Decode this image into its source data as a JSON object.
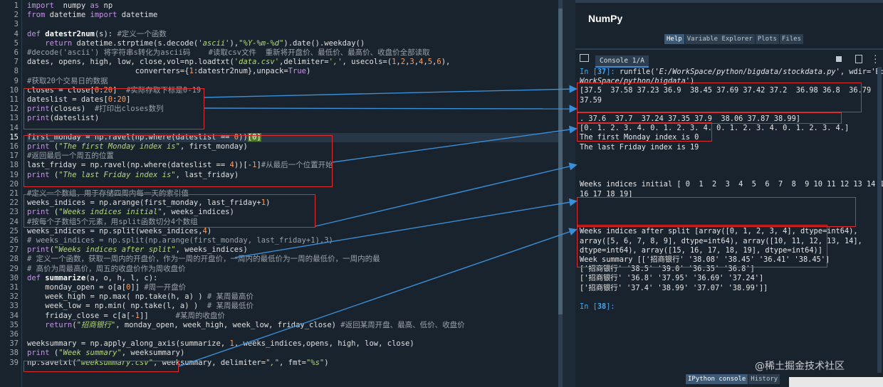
{
  "editor": {
    "lines": [
      {
        "n": "1",
        "segs": [
          [
            "kw",
            "import"
          ],
          [
            "",
            "  numpy "
          ],
          [
            "kw",
            "as"
          ],
          [
            "",
            " np"
          ]
        ]
      },
      {
        "n": "2",
        "segs": [
          [
            "kw",
            "from"
          ],
          [
            "",
            " datetime "
          ],
          [
            "kw",
            "import"
          ],
          [
            "",
            " datetime"
          ]
        ]
      },
      {
        "n": "3",
        "segs": []
      },
      {
        "n": "4",
        "segs": [
          [
            "kw",
            "def"
          ],
          [
            "",
            " "
          ],
          [
            "fnd",
            "datestr2num"
          ],
          [
            "",
            "(s): "
          ],
          [
            "cm",
            "#定义一个函数"
          ]
        ]
      },
      {
        "n": "5",
        "segs": [
          [
            "",
            "    "
          ],
          [
            "kw",
            "return"
          ],
          [
            "",
            " datetime.strptime(s.decode("
          ],
          [
            "str",
            "'ascii'"
          ],
          [
            "",
            "),"
          ],
          [
            "str",
            "\"%Y-%m-%d\""
          ],
          [
            "",
            ").date().weekday()"
          ]
        ]
      },
      {
        "n": "6",
        "segs": [
          [
            "cm",
            "#decode('ascii') 将字符串s转化为ascii码    #读取csv文件  重新将开盘价、最低价、最高价、收盘价全部读取"
          ]
        ]
      },
      {
        "n": "7",
        "segs": [
          [
            "",
            "dates, opens, high, low, close,vol=np.loadtxt("
          ],
          [
            "str",
            "'data.csv'"
          ],
          [
            "",
            ",delimiter="
          ],
          [
            "str",
            "','"
          ],
          [
            "",
            ", usecols=("
          ],
          [
            "num",
            "1"
          ],
          [
            "",
            ","
          ],
          [
            "num",
            "2"
          ],
          [
            "",
            ","
          ],
          [
            "num",
            "3"
          ],
          [
            "",
            ","
          ],
          [
            "num",
            "4"
          ],
          [
            "",
            ","
          ],
          [
            "num",
            "5"
          ],
          [
            "",
            ","
          ],
          [
            "num",
            "6"
          ],
          [
            "",
            "),"
          ]
        ]
      },
      {
        "n": "8",
        "segs": [
          [
            "",
            "                        converters={"
          ],
          [
            "num",
            "1"
          ],
          [
            "",
            ":datestr2num},unpack="
          ],
          [
            "kw",
            "True"
          ],
          [
            "",
            ")"
          ]
        ]
      },
      {
        "n": "9",
        "segs": [
          [
            "cm",
            "#获取20个交易日的数据"
          ]
        ]
      },
      {
        "n": "10",
        "segs": [
          [
            "",
            "closes = close["
          ],
          [
            "num",
            "0"
          ],
          [
            "",
            ":"
          ],
          [
            "num",
            "20"
          ],
          [
            "",
            "]  "
          ],
          [
            "cm",
            "#实际存取下标是0-19"
          ]
        ]
      },
      {
        "n": "11",
        "segs": [
          [
            "",
            "dateslist = dates["
          ],
          [
            "num",
            "0"
          ],
          [
            "",
            ":"
          ],
          [
            "num",
            "20"
          ],
          [
            "",
            "]"
          ]
        ]
      },
      {
        "n": "12",
        "segs": [
          [
            "kw",
            "print"
          ],
          [
            "",
            "(closes)  "
          ],
          [
            "cm",
            "#打印出closes数列"
          ]
        ]
      },
      {
        "n": "13",
        "segs": [
          [
            "kw",
            "print"
          ],
          [
            "",
            "(dateslist)"
          ]
        ]
      },
      {
        "n": "14",
        "segs": []
      },
      {
        "n": "15",
        "cur": true,
        "segs": [
          [
            "",
            "first_monday = np.ravel(np.where(dateslist == "
          ],
          [
            "num",
            "0"
          ],
          [
            "",
            "))"
          ],
          [
            "sel",
            "[0]"
          ]
        ]
      },
      {
        "n": "16",
        "segs": [
          [
            "kw",
            "print"
          ],
          [
            "",
            " ("
          ],
          [
            "str",
            "\"The first Monday index is\""
          ],
          [
            "",
            ", first_monday)"
          ]
        ]
      },
      {
        "n": "17",
        "segs": [
          [
            "cm",
            "#返回最后一个周五的位置"
          ]
        ]
      },
      {
        "n": "18",
        "segs": [
          [
            "",
            "last_friday = np.ravel(np.where(dateslist == "
          ],
          [
            "num",
            "4"
          ],
          [
            "",
            "))[-"
          ],
          [
            "num",
            "1"
          ],
          [
            "",
            "]"
          ],
          [
            "cm",
            "#从最后一个位置开始"
          ]
        ]
      },
      {
        "n": "19",
        "segs": [
          [
            "kw",
            "print"
          ],
          [
            "",
            " ("
          ],
          [
            "str",
            "\"The last Friday index is\""
          ],
          [
            "",
            ", last_friday)"
          ]
        ]
      },
      {
        "n": "20",
        "segs": []
      },
      {
        "n": "21",
        "segs": [
          [
            "cm",
            "#定义一个数组，用于存储四周内每一天的索引值"
          ]
        ]
      },
      {
        "n": "22",
        "segs": [
          [
            "",
            "weeks_indices = np.arange(first_monday, last_friday+"
          ],
          [
            "num",
            "1"
          ],
          [
            "",
            ")"
          ]
        ]
      },
      {
        "n": "23",
        "segs": [
          [
            "kw",
            "print"
          ],
          [
            "",
            " ("
          ],
          [
            "str",
            "\"Weeks indices initial\""
          ],
          [
            "",
            ", weeks_indices)"
          ]
        ]
      },
      {
        "n": "24",
        "segs": [
          [
            "cm",
            "#按每个子数组5个元素，用split函数切分4个数组"
          ]
        ]
      },
      {
        "n": "25",
        "segs": [
          [
            "",
            "weeks_indices = np.split(weeks_indices,"
          ],
          [
            "num",
            "4"
          ],
          [
            "",
            ")"
          ]
        ]
      },
      {
        "n": "26",
        "segs": [
          [
            "cm",
            "# weeks_indices = np.split(np.arange(first_monday, last_friday+1),3)"
          ]
        ]
      },
      {
        "n": "27",
        "segs": [
          [
            "kw",
            "print"
          ],
          [
            "",
            "("
          ],
          [
            "str",
            "\"Weeks indices after split\""
          ],
          [
            "",
            ", weeks_indices)"
          ]
        ]
      },
      {
        "n": "28",
        "segs": [
          [
            "cm",
            "# 定义一个函数，获取一周内的开盘价，作为一周的开盘价，一周内的最低价为一周的最低价，一周内的最"
          ]
        ]
      },
      {
        "n": "29",
        "segs": [
          [
            "cm",
            "# 高价为周最高价，周五的收盘价作为周收盘价"
          ]
        ]
      },
      {
        "n": "30",
        "segs": [
          [
            "kw",
            "def"
          ],
          [
            "",
            " "
          ],
          [
            "fnd",
            "summarize"
          ],
          [
            "",
            "(a, o, h, l, c):"
          ]
        ]
      },
      {
        "n": "31",
        "segs": [
          [
            "",
            "    monday_open = o[a["
          ],
          [
            "num",
            "0"
          ],
          [
            "",
            "]] "
          ],
          [
            "cm",
            "#周一开盘价"
          ]
        ]
      },
      {
        "n": "32",
        "segs": [
          [
            "",
            "    week_high = np.max( np.take(h, a) ) "
          ],
          [
            "cm",
            "# 某周最高价"
          ]
        ]
      },
      {
        "n": "33",
        "segs": [
          [
            "",
            "    week_low = np.min( np.take(l, a) )  "
          ],
          [
            "cm",
            "# 某周最低价"
          ]
        ]
      },
      {
        "n": "34",
        "segs": [
          [
            "",
            "    friday_close = c[a[-"
          ],
          [
            "num",
            "1"
          ],
          [
            "",
            "]]      "
          ],
          [
            "cm",
            "#某周的收盘价"
          ]
        ]
      },
      {
        "n": "35",
        "segs": [
          [
            "",
            "    "
          ],
          [
            "kw",
            "return"
          ],
          [
            "",
            "("
          ],
          [
            "str",
            "\"招商银行\""
          ],
          [
            "",
            ", monday_open, week_high, week_low, friday_close) "
          ],
          [
            "cm",
            "#返回某周开盘、最高、低价、收盘价"
          ]
        ]
      },
      {
        "n": "36",
        "segs": []
      },
      {
        "n": "37",
        "segs": [
          [
            "",
            "weeksummary = np.apply_along_axis(summarize, "
          ],
          [
            "num",
            "1"
          ],
          [
            "",
            ", weeks_indices,opens, high, low, close)"
          ]
        ]
      },
      {
        "n": "38",
        "segs": [
          [
            "kw",
            "print"
          ],
          [
            "",
            " ("
          ],
          [
            "str",
            "\"Week summary\""
          ],
          [
            "",
            ", weeksummary)"
          ]
        ]
      },
      {
        "n": "39",
        "segs": [
          [
            "",
            "np.savetxt("
          ],
          [
            "str",
            "\"weeksummary.csv\""
          ],
          [
            "",
            ", weeksummary, delimiter="
          ],
          [
            "str",
            "\",\""
          ],
          [
            "",
            ", fmt="
          ],
          [
            "str",
            "\"%s\""
          ],
          [
            "",
            ")"
          ]
        ]
      }
    ]
  },
  "help": {
    "title": "NumPy",
    "tabs": [
      "Help",
      "Variable Explorer",
      "Plots",
      "Files"
    ],
    "active_tab": 0
  },
  "console": {
    "tab_label": "Console 1/A",
    "lines": [
      [
        [
          "prompt",
          "In ["
        ],
        [
          "pnum",
          "37"
        ],
        [
          "prompt",
          "]: "
        ],
        [
          "",
          "runfile("
        ],
        [
          "pathc",
          "'E:/WorkSpace/python/bigdata/stockdata.py'"
        ],
        [
          "",
          ", wdir='E:/"
        ]
      ],
      [
        [
          "pathc",
          "WorkSpace/python/bigdata'"
        ],
        [
          "",
          ")"
        ]
      ],
      [
        [
          "",
          "[37.5  37.58 37.23 36.9  38.45 37.69 37.42 37.2  36.98 36.8  36.79"
        ]
      ],
      [
        [
          "",
          "37.59"
        ]
      ],
      [
        [
          "",
          ""
        ]
      ],
      [
        [
          "",
          ". 37.6  37.7  37.24 37.35 37.9  38.06 37.87 38.99]"
        ]
      ],
      [
        [
          "",
          "[0. 1. 2. 3. 4. 0. 1. 2. 3. 4. 0. 1. 2. 3. 4. 0. 1. 2. 3. 4.]"
        ]
      ],
      [
        [
          "",
          "The first Monday index is 0"
        ]
      ],
      [
        [
          "",
          "The last Friday index is 19"
        ]
      ],
      [
        [
          "",
          ""
        ]
      ],
      [
        [
          "",
          ""
        ]
      ],
      [
        [
          "",
          ""
        ]
      ],
      [
        [
          "",
          "Weeks indices initial [ 0  1  2  3  4  5  6  7  8  9 10 11 12 13 14 15"
        ]
      ],
      [
        [
          "",
          "16 17 18 19]"
        ]
      ],
      [
        [
          "",
          ""
        ]
      ],
      [
        [
          "",
          ""
        ]
      ],
      [
        [
          "",
          ""
        ]
      ],
      [
        [
          "",
          "Weeks indices after split [array([0, 1, 2, 3, 4], dtype=int64),"
        ]
      ],
      [
        [
          "",
          "array([5, 6, 7, 8, 9], dtype=int64), array([10, 11, 12, 13, 14],"
        ]
      ],
      [
        [
          "",
          "dtype=int64), array([15, 16, 17, 18, 19], dtype=int64)]"
        ]
      ],
      [
        [
          "",
          "Week summary [['招商银行' '38.08' '38.45' '36.41' '38.45']"
        ]
      ],
      [
        [
          "",
          "['招商银行' '38.5' '39.0' '36.35' '36.8']"
        ]
      ],
      [
        [
          "",
          "['招商银行' '36.8' '37.95' '36.69' '37.24']"
        ]
      ],
      [
        [
          "",
          "['招商银行' '37.4' '38.99' '37.07' '38.99']]"
        ]
      ],
      [
        [
          "",
          ""
        ]
      ],
      [
        [
          "prompt",
          "In ["
        ],
        [
          "pnum",
          "38"
        ],
        [
          "prompt",
          "]:"
        ]
      ]
    ],
    "bottom_tabs": [
      "IPython console",
      "History"
    ],
    "active_bottom_tab": 0
  },
  "watermark": "@稀土掘金技术社区",
  "colors": {
    "annotation": "#e02b2b",
    "arrow": "#3a8fd8",
    "background": "#19232d"
  }
}
